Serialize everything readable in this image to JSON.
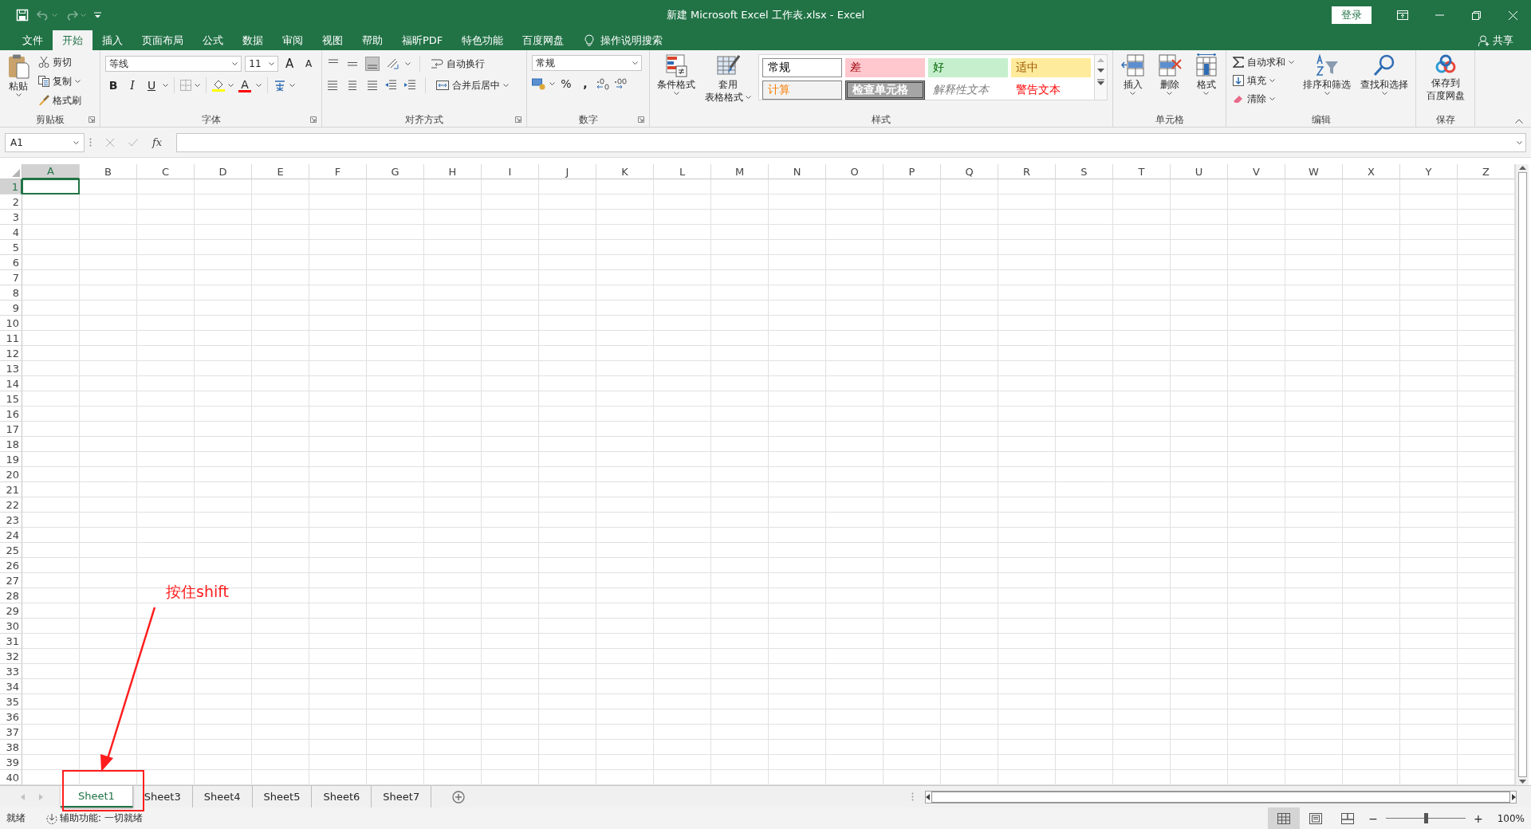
{
  "title_bar": {
    "title": "新建 Microsoft Excel 工作表.xlsx  -  Excel",
    "login": "登录"
  },
  "menu_tabs": [
    {
      "label": "文件",
      "selected": false
    },
    {
      "label": "开始",
      "selected": true
    },
    {
      "label": "插入",
      "selected": false
    },
    {
      "label": "页面布局",
      "selected": false
    },
    {
      "label": "公式",
      "selected": false
    },
    {
      "label": "数据",
      "selected": false
    },
    {
      "label": "审阅",
      "selected": false
    },
    {
      "label": "视图",
      "selected": false
    },
    {
      "label": "帮助",
      "selected": false
    },
    {
      "label": "福昕PDF",
      "selected": false
    },
    {
      "label": "特色功能",
      "selected": false
    },
    {
      "label": "百度网盘",
      "selected": false
    }
  ],
  "tell_me": "操作说明搜索",
  "share": "共享",
  "ribbon": {
    "clipboard": {
      "paste": "粘贴",
      "cut": "剪切",
      "copy": "复制",
      "format_painter": "格式刷",
      "label": "剪贴板"
    },
    "font": {
      "font_name": "等线",
      "font_size": "11",
      "grow": "A",
      "shrink": "A",
      "bold": "B",
      "italic": "I",
      "underline": "U",
      "font_color": "A",
      "label": "字体"
    },
    "alignment": {
      "wrap_text": "自动换行",
      "merge_center": "合并后居中",
      "label": "对齐方式"
    },
    "number": {
      "format": "常规",
      "percent": "%",
      "comma": ",",
      "label": "数字"
    },
    "styles": {
      "conditional": "条件格式",
      "table": [
        "套用",
        "表格格式"
      ],
      "label": "样式",
      "cell_styles": [
        {
          "label": "常规",
          "kind": "normal"
        },
        {
          "label": "差",
          "kind": "bad"
        },
        {
          "label": "好",
          "kind": "good"
        },
        {
          "label": "适中",
          "kind": "neutral"
        },
        {
          "label": "计算",
          "kind": "calculation"
        },
        {
          "label": "检查单元格",
          "kind": "check"
        },
        {
          "label": "解释性文本",
          "kind": "explanatory"
        },
        {
          "label": "警告文本",
          "kind": "warning"
        }
      ]
    },
    "cells": {
      "label": "单元格",
      "buttons": [
        {
          "label": "插入",
          "kind": "insert"
        },
        {
          "label": "删除",
          "kind": "delete"
        },
        {
          "label": "格式",
          "kind": "format"
        }
      ]
    },
    "editing": {
      "autosum": "自动求和",
      "fill": "填充",
      "clear": "清除",
      "sort_filter": "排序和筛选",
      "find_select": "查找和选择",
      "label": "编辑"
    },
    "save": {
      "button": [
        "保存到",
        "百度网盘"
      ],
      "label": "保存"
    }
  },
  "formula_bar": {
    "name_box": "A1",
    "fx": "fx"
  },
  "columns": [
    {
      "label": "A",
      "selected": true
    },
    {
      "label": "B",
      "selected": false
    },
    {
      "label": "C",
      "selected": false
    },
    {
      "label": "D",
      "selected": false
    },
    {
      "label": "E",
      "selected": false
    },
    {
      "label": "F",
      "selected": false
    },
    {
      "label": "G",
      "selected": false
    },
    {
      "label": "H",
      "selected": false
    },
    {
      "label": "I",
      "selected": false
    },
    {
      "label": "J",
      "selected": false
    },
    {
      "label": "K",
      "selected": false
    },
    {
      "label": "L",
      "selected": false
    },
    {
      "label": "M",
      "selected": false
    },
    {
      "label": "N",
      "selected": false
    },
    {
      "label": "O",
      "selected": false
    },
    {
      "label": "P",
      "selected": false
    },
    {
      "label": "Q",
      "selected": false
    },
    {
      "label": "R",
      "selected": false
    },
    {
      "label": "S",
      "selected": false
    },
    {
      "label": "T",
      "selected": false
    },
    {
      "label": "U",
      "selected": false
    },
    {
      "label": "V",
      "selected": false
    },
    {
      "label": "W",
      "selected": false
    },
    {
      "label": "X",
      "selected": false
    },
    {
      "label": "Y",
      "selected": false
    },
    {
      "label": "Z",
      "selected": false
    }
  ],
  "rows": [
    {
      "label": "1",
      "selected": true
    },
    {
      "label": "2",
      "selected": false
    },
    {
      "label": "3",
      "selected": false
    },
    {
      "label": "4",
      "selected": false
    },
    {
      "label": "5",
      "selected": false
    },
    {
      "label": "6",
      "selected": false
    },
    {
      "label": "7",
      "selected": false
    },
    {
      "label": "8",
      "selected": false
    },
    {
      "label": "9",
      "selected": false
    },
    {
      "label": "10",
      "selected": false
    },
    {
      "label": "11",
      "selected": false
    },
    {
      "label": "12",
      "selected": false
    },
    {
      "label": "13",
      "selected": false
    },
    {
      "label": "14",
      "selected": false
    },
    {
      "label": "15",
      "selected": false
    },
    {
      "label": "16",
      "selected": false
    },
    {
      "label": "17",
      "selected": false
    },
    {
      "label": "18",
      "selected": false
    },
    {
      "label": "19",
      "selected": false
    },
    {
      "label": "20",
      "selected": false
    },
    {
      "label": "21",
      "selected": false
    },
    {
      "label": "22",
      "selected": false
    },
    {
      "label": "23",
      "selected": false
    },
    {
      "label": "24",
      "selected": false
    },
    {
      "label": "25",
      "selected": false
    },
    {
      "label": "26",
      "selected": false
    },
    {
      "label": "27",
      "selected": false
    },
    {
      "label": "28",
      "selected": false
    },
    {
      "label": "29",
      "selected": false
    },
    {
      "label": "30",
      "selected": false
    },
    {
      "label": "31",
      "selected": false
    },
    {
      "label": "32",
      "selected": false
    },
    {
      "label": "33",
      "selected": false
    },
    {
      "label": "34",
      "selected": false
    },
    {
      "label": "35",
      "selected": false
    },
    {
      "label": "36",
      "selected": false
    },
    {
      "label": "37",
      "selected": false
    },
    {
      "label": "38",
      "selected": false
    },
    {
      "label": "39",
      "selected": false
    },
    {
      "label": "40",
      "selected": false
    }
  ],
  "sheets": [
    {
      "label": "Sheet1",
      "selected": true
    },
    {
      "label": "Sheet3",
      "selected": false
    },
    {
      "label": "Sheet4",
      "selected": false
    },
    {
      "label": "Sheet5",
      "selected": false
    },
    {
      "label": "Sheet6",
      "selected": false
    },
    {
      "label": "Sheet7",
      "selected": false
    }
  ],
  "status_bar": {
    "ready": "就绪",
    "accessibility": "辅助功能: 一切就绪",
    "views": [
      {
        "kind": "normal",
        "selected": true
      },
      {
        "kind": "page_layout",
        "selected": false
      },
      {
        "kind": "page_break",
        "selected": false
      }
    ],
    "zoom_out": "−",
    "zoom_slider": {
      "level": 0.5
    },
    "zoom_in": "+",
    "zoom": "100%"
  },
  "annotation": {
    "text": "按住shift"
  }
}
